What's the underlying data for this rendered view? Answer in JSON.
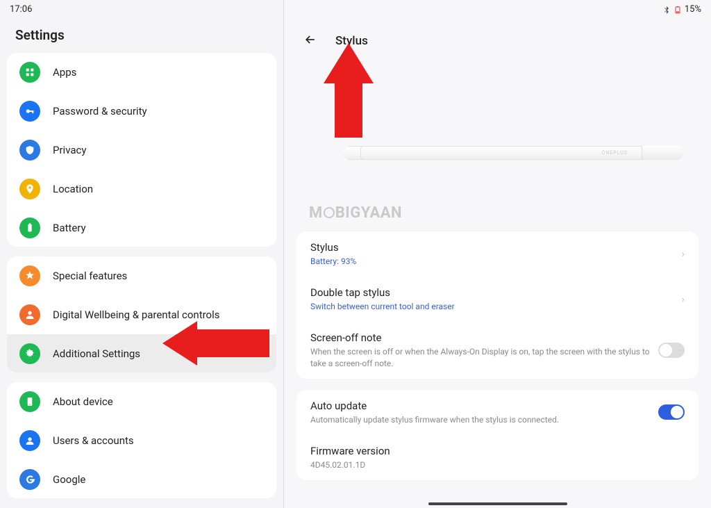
{
  "status": {
    "time": "17:06",
    "battery_pct": "15%"
  },
  "settings_title": "Settings",
  "sidebar": {
    "group1": [
      {
        "label": "Apps"
      },
      {
        "label": "Password & security"
      },
      {
        "label": "Privacy"
      },
      {
        "label": "Location"
      },
      {
        "label": "Battery"
      }
    ],
    "group2": [
      {
        "label": "Special features"
      },
      {
        "label": "Digital Wellbeing & parental controls"
      },
      {
        "label": "Additional Settings"
      }
    ],
    "group3": [
      {
        "label": "About device"
      },
      {
        "label": "Users & accounts"
      },
      {
        "label": "Google"
      }
    ]
  },
  "detail": {
    "title": "Stylus",
    "stylus_brand": "ONEPLUS",
    "watermark_prefix": "M",
    "watermark_suffix": "BIGYAAN",
    "section1": {
      "stylus": {
        "title": "Stylus",
        "sub": "Battery: 93%"
      },
      "double_tap": {
        "title": "Double tap stylus",
        "sub": "Switch between current tool and eraser"
      },
      "screen_off": {
        "title": "Screen-off note",
        "sub": "When the screen is off or when the Always-On Display is on, tap the screen with the stylus to take a screen-off note."
      }
    },
    "section2": {
      "auto_update": {
        "title": "Auto update",
        "sub": "Automatically update stylus firmware when the stylus is connected."
      },
      "firmware": {
        "title": "Firmware version",
        "sub": "4D45.02.01.1D"
      }
    }
  },
  "toggles": {
    "screen_off": false,
    "auto_update": true
  }
}
